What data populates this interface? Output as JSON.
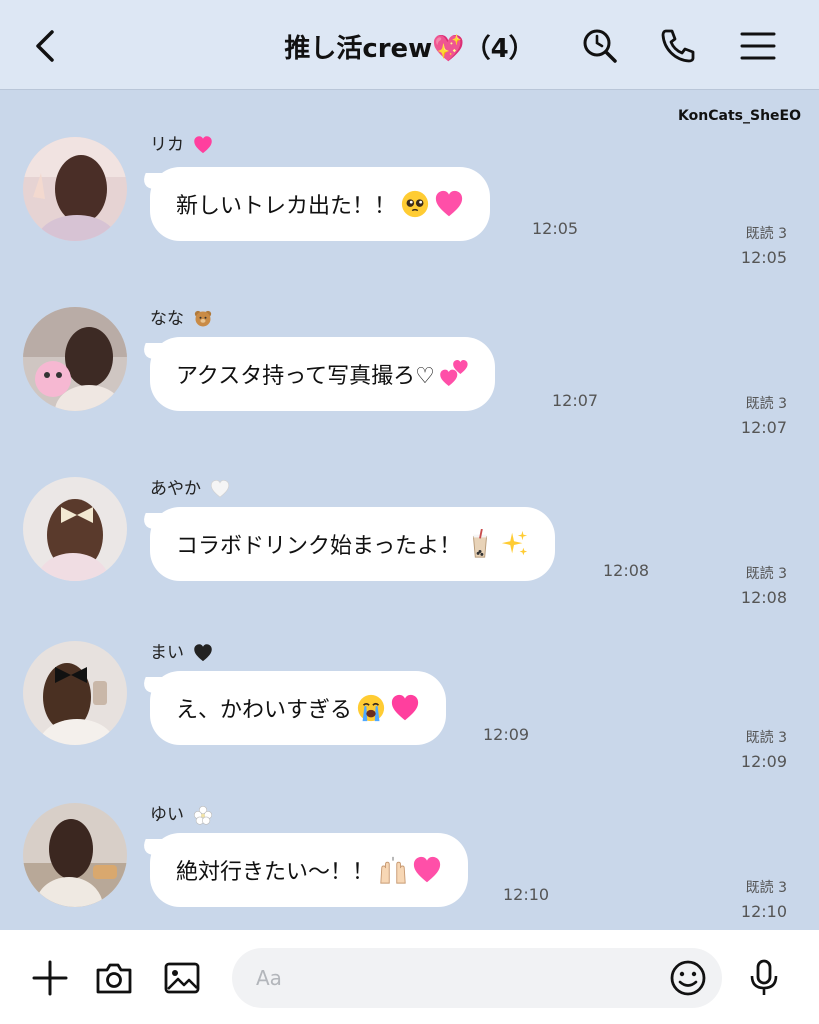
{
  "header": {
    "title": "推し活crew💖（4）"
  },
  "watermark": "KonCats_SheEO",
  "messages": [
    {
      "sender": "リカ",
      "text": "新しいトレカ出た！！",
      "time": "12:05",
      "read_label": "既読 3",
      "read_time": "12:05",
      "sender_emoji": "sparkling-heart",
      "text_emojis": [
        "pleading-face",
        "growing-heart"
      ]
    },
    {
      "sender": "なな",
      "text": "アクスタ持って写真撮ろ♡",
      "time": "12:07",
      "read_label": "既読 3",
      "read_time": "12:07",
      "sender_emoji": "teddy-bear",
      "text_emojis": [
        "two-hearts"
      ]
    },
    {
      "sender": "あやか",
      "text": "コラボドリンク始まったよ！",
      "time": "12:08",
      "read_label": "既読 3",
      "read_time": "12:08",
      "sender_emoji": "white-heart",
      "text_emojis": [
        "bubble-tea",
        "sparkles"
      ]
    },
    {
      "sender": "まい",
      "text": "え、かわいすぎる",
      "time": "12:09",
      "read_label": "既読 3",
      "read_time": "12:09",
      "sender_emoji": "black-heart",
      "text_emojis": [
        "crying-face",
        "sparkling-heart"
      ]
    },
    {
      "sender": "ゆい",
      "text": "絶対行きたい〜！！",
      "time": "12:10",
      "read_label": "既読 3",
      "read_time": "12:10",
      "sender_emoji": "white-flower",
      "text_emojis": [
        "raising-hands",
        "growing-heart"
      ]
    }
  ],
  "composer": {
    "placeholder": "Aa"
  },
  "colors": {
    "background": "#c9d7ea",
    "header_bg": "#dde7f4",
    "bubble": "#ffffff",
    "heart_pink": "#ff3f9e"
  }
}
